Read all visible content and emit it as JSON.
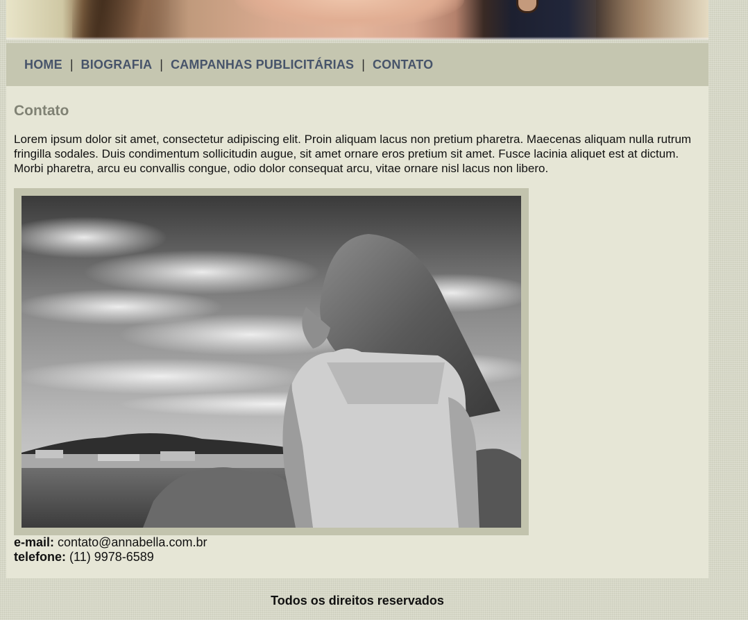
{
  "nav": {
    "items": [
      {
        "label": "HOME"
      },
      {
        "label": "BIOGRAFIA"
      },
      {
        "label": "CAMPANHAS PUBLICITÁRIAS"
      },
      {
        "label": "CONTATO"
      }
    ],
    "separator": "|"
  },
  "content": {
    "title": "Contato",
    "body": "Lorem ipsum dolor sit amet, consectetur adipiscing elit. Proin aliquam lacus non pretium pharetra. Maecenas aliquam nulla rutrum fringilla sodales. Duis condimentum sollicitudin augue, sit amet ornare eros pretium sit amet. Fusce lacinia aliquet est at dictum. Morbi pharetra, arcu eu convallis congue, odio dolor consequat arcu, vitae ornare nisl lacus non libero.",
    "email_label": "e-mail:",
    "email_value": "contato@annabella.com.br",
    "phone_label": "telefone:",
    "phone_value": "(11) 9978-6589"
  },
  "footer": {
    "text": "Todos os direitos reservados"
  },
  "colors": {
    "nav_bg": "#c5c6b0",
    "nav_link": "#47546a",
    "content_bg": "#e6e6d6",
    "title": "#808274"
  }
}
